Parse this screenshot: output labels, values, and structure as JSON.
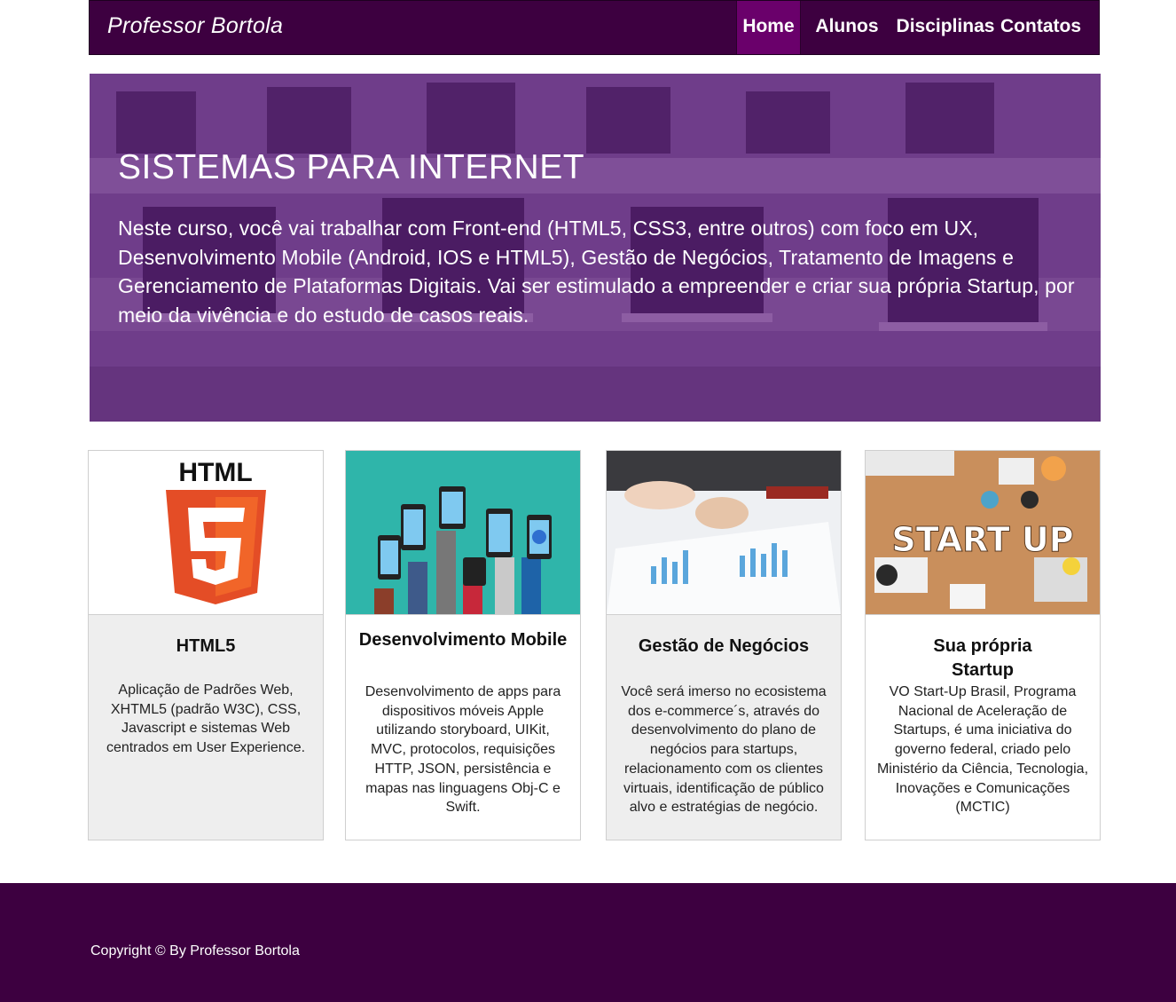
{
  "brand": "Professor Bortola",
  "nav": {
    "items": [
      {
        "label": "Home",
        "active": true
      },
      {
        "label": "Alunos",
        "active": false
      },
      {
        "label": "Disciplinas",
        "active": false
      },
      {
        "label": "Contatos",
        "active": false
      }
    ]
  },
  "hero": {
    "title": "SISTEMAS PARA INTERNET",
    "text": "Neste curso, você vai trabalhar com Front-end (HTML5, CSS3, entre outros) com foco em UX, Desenvolvimento Mobile (Android, IOS e HTML5), Gestão de Negócios, Tratamento de Imagens e Gerenciamento de Plataformas Digitais. Vai ser estimulado a empreender e criar sua própria Startup, por meio da vivência e do estudo de casos reais."
  },
  "cards": [
    {
      "title": "HTML5",
      "image_label": "HTML",
      "text": "Aplicação de Padrões Web, XHTML5 (padrão W3C), CSS, Javascript e sistemas Web centrados em User Experience."
    },
    {
      "title": "Desenvolvimento Mobile",
      "text": "Desenvolvimento de apps para dispositivos móveis Apple utilizando storyboard, UIKit, MVC, protocolos, requisições HTTP, JSON, persistência e mapas nas linguagens Obj-C e Swift."
    },
    {
      "title": "Gestão de Negócios",
      "text": "Você será imerso no ecosistema dos e-commerce´s, através do desenvolvimento do plano de negócios para startups, relacionamento com os clientes virtuais, identificação de público alvo e estratégias de negócio."
    },
    {
      "title": "Sua própria Startup",
      "image_label": "START UP",
      "text": "VO Start-Up Brasil, Programa Nacional de Aceleração de Startups, é uma iniciativa do governo federal, criado pelo Ministério da Ciência, Tecnologia, Inovações e Comunicações (MCTIC)"
    }
  ],
  "footer": {
    "copyright": "Copyright © By Professor Bortola"
  },
  "colors": {
    "primary": "#3d0040",
    "active": "#6a006b",
    "hero_overlay": "#5f1982",
    "card_gray": "#eeeeee"
  }
}
